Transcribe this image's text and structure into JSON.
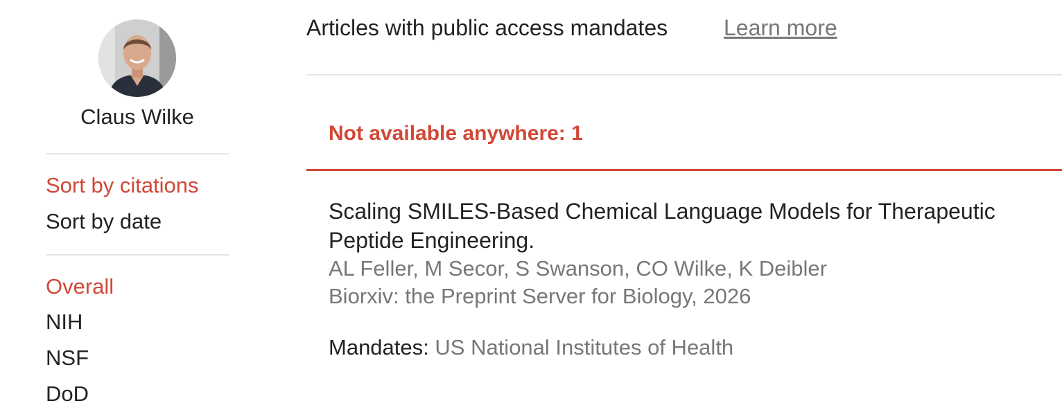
{
  "profile": {
    "name": "Claus Wilke"
  },
  "sidebar": {
    "sort_options": [
      {
        "label": "Sort by citations",
        "active": true
      },
      {
        "label": "Sort by date",
        "active": false
      }
    ],
    "filters": [
      {
        "label": "Overall",
        "active": true
      },
      {
        "label": "NIH",
        "active": false
      },
      {
        "label": "NSF",
        "active": false
      },
      {
        "label": "DoD",
        "active": false
      }
    ]
  },
  "header": {
    "title": "Articles with public access mandates",
    "learn_more": "Learn more"
  },
  "section": {
    "title": "Not available anywhere: 1"
  },
  "article": {
    "title": "Scaling SMILES-Based Chemical Language Models for Therapeutic Peptide Engineering.",
    "authors": "AL Feller, M Secor, S Swanson, CO Wilke, K Deibler",
    "venue": "Biorxiv: the Preprint Server for Biology, 2026",
    "mandates_label": "Mandates:",
    "mandates_value": "US National Institutes of Health"
  },
  "colors": {
    "accent": "#d14836",
    "text": "#222222",
    "muted": "#777777",
    "divider": "#e5e5e5"
  }
}
